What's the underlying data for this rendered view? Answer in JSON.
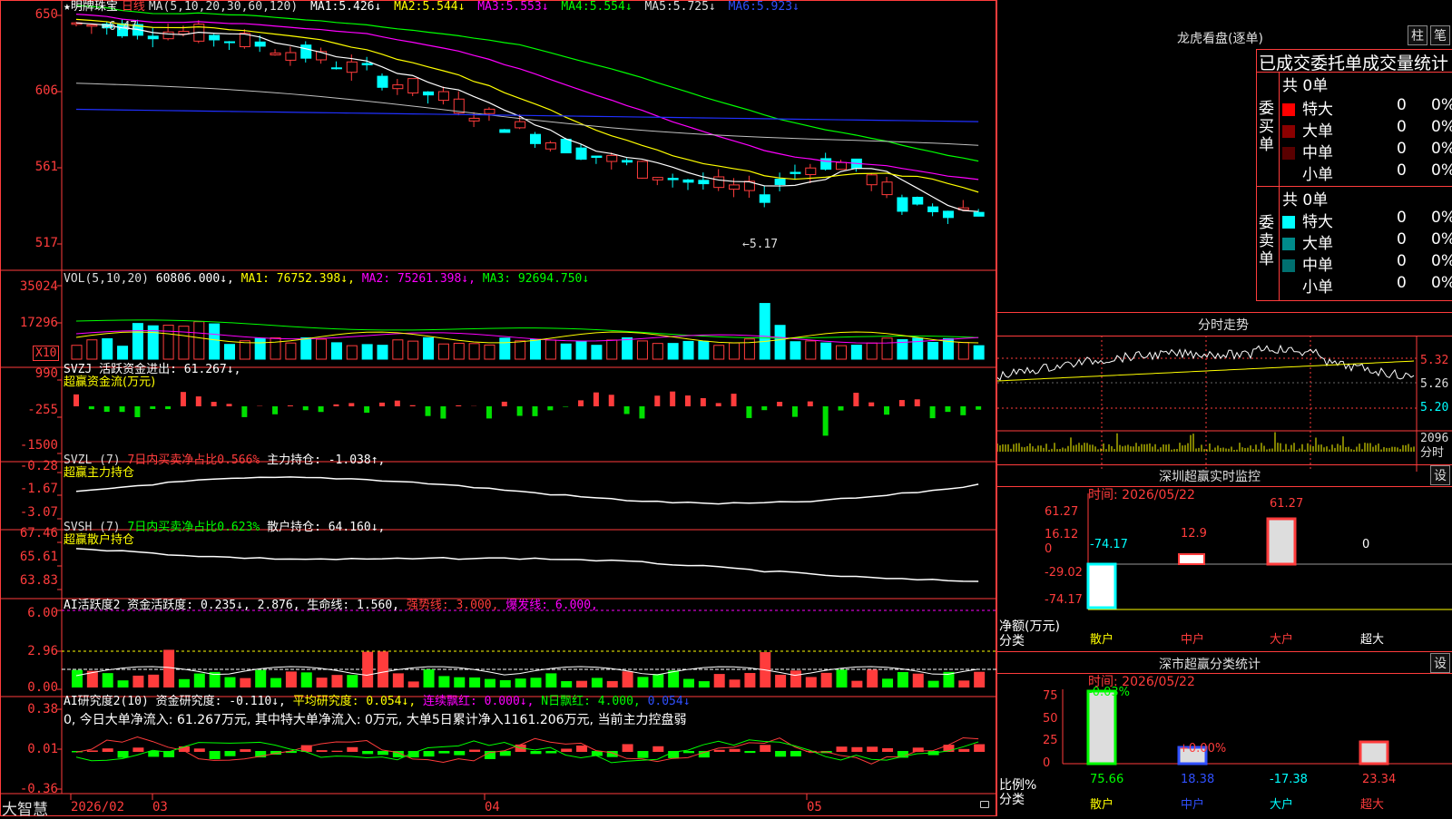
{
  "header": {
    "stock_name": "★明牌珠宝",
    "period": "日线",
    "ma_def": "MA(5,10,20,30,60,120)",
    "ma": [
      {
        "label": "MA1:",
        "value": "5.426↓",
        "color": "#ffffff"
      },
      {
        "label": "MA2:",
        "value": "5.544↓",
        "color": "#ffff00"
      },
      {
        "label": "MA3:",
        "value": "5.553↓",
        "color": "#ff00ff"
      },
      {
        "label": "MA4:",
        "value": "5.554↓",
        "color": "#00ff00"
      },
      {
        "label": "MA5:",
        "value": "5.725↓",
        "color": "#d0d0d0"
      },
      {
        "label": "MA6:",
        "value": "5.923↓",
        "color": "#2020ff"
      }
    ]
  },
  "price_axis": [
    "650",
    "606",
    "561",
    "517"
  ],
  "price_annotations": {
    "high": "←6.47",
    "low": "←5.17"
  },
  "vol": {
    "title": "VOL(5,10,20)",
    "value": "60806.000↓,",
    "ma1": "MA1: 76752.398↓,",
    "ma2": "MA2: 75261.398↓,",
    "ma3": "MA3: 92694.750↓",
    "axis": [
      "35024",
      "17296"
    ],
    "unit": "X10"
  },
  "svzj": {
    "title": "SVZJ  活跃资金进出: 61.267↓,",
    "subtitle": "超赢资金流(万元)",
    "axis": [
      "990",
      "-255",
      "-1500"
    ]
  },
  "svzl": {
    "title": "SVZL (7)",
    "part2": "7日内买卖净占比0.566%",
    "part3": "主力持仓: -1.038↑,",
    "subtitle": "超赢主力持仓",
    "axis": [
      "-0.28",
      "-1.67",
      "-3.07"
    ]
  },
  "svsh": {
    "title": "SVSH (7)",
    "part2": "7日内买卖净占比0.623%",
    "part3": "散户持仓: 64.160↓,",
    "subtitle": "超赢散户持仓",
    "axis": [
      "67.46",
      "65.61",
      "63.83"
    ]
  },
  "ai_active": {
    "title": "AI活跃度2 资金活跃度: 0.235↓, 2.876, 生命线: 1.560,",
    "strong": "强势线: 3.000,",
    "burst": "爆发线: 6.000,",
    "axis": [
      "6.00",
      "2.96",
      "0.00"
    ]
  },
  "ai_research": {
    "title": "AI研究度2(10) 资金研究度: -0.110↓,",
    "avg": "平均研究度: 0.054↓,",
    "red": "连续飘红: 0.000↓,",
    "nred": "N日飘红: 4.000,",
    "last": "0.054↓",
    "desc": "0, 今日大单净流入: 61.267万元, 其中特大单净流入: 0万元, 大单5日累计净入1161.206万元, 当前主力控盘弱",
    "axis": [
      "0.38",
      "0.01",
      "-0.36"
    ]
  },
  "date_axis": {
    "brand": "大智慧",
    "labels": [
      "2026/02",
      "03",
      "04",
      "05"
    ]
  },
  "dragon_tiger": {
    "title": "龙虎看盘(逐单)",
    "btn_bar": "柱",
    "btn_tick": "笔",
    "tabs": "已成交委托单成交量统计",
    "buy_label": "委买单",
    "sell_label": "委卖单",
    "buy_total": "共 0单",
    "sell_total": "共 0单",
    "buy_rows": [
      {
        "name": "特大",
        "count": "0",
        "pct": "0%",
        "color": "#ff0000"
      },
      {
        "name": "大单",
        "count": "0",
        "pct": "0%",
        "color": "#8b0000"
      },
      {
        "name": "中单",
        "count": "0",
        "pct": "0%",
        "color": "#5a0000"
      },
      {
        "name": "小单",
        "count": "0",
        "pct": "0%",
        "color": "#000000"
      }
    ],
    "sell_rows": [
      {
        "name": "特大",
        "count": "0",
        "pct": "0%",
        "color": "#00ffff"
      },
      {
        "name": "大单",
        "count": "0",
        "pct": "0%",
        "color": "#008b8b"
      },
      {
        "name": "中单",
        "count": "0",
        "pct": "0%",
        "color": "#007070"
      },
      {
        "name": "小单",
        "count": "0",
        "pct": "0%",
        "color": "#000000"
      }
    ]
  },
  "intraday": {
    "title": "分时走势",
    "axis": [
      "5.32",
      "5.26",
      "5.20"
    ],
    "vol_top": "2096",
    "vol_unit": "分时"
  },
  "realtime": {
    "title": "深圳超赢实时监控",
    "set": "设",
    "time": "时间: 2026/05/22",
    "axis": [
      "61.27",
      "16.12",
      "0",
      "-29.02",
      "-74.17"
    ],
    "ylabel": "净额(万元)",
    "xlabel": "分类",
    "categories": [
      "散户",
      "中户",
      "大户",
      "超大"
    ],
    "values": [
      "-74.17",
      "12.9",
      "61.27",
      "0"
    ]
  },
  "classify": {
    "title": "深市超赢分类统计",
    "set": "设",
    "time": "时间: 2026/05/22",
    "axis": [
      "75",
      "50",
      "25",
      "0"
    ],
    "ylabel": "比例%",
    "xlabel": "分类",
    "categories": [
      "散户",
      "中户",
      "大户",
      "超大"
    ],
    "top_labels": [
      "-0.03%",
      "+0.00%"
    ],
    "values": [
      "75.66",
      "18.38",
      "-17.38",
      "23.34"
    ]
  },
  "chart_data": {
    "type": "candlestick",
    "title": "明牌珠宝 日线",
    "ylim": [
      5.1,
      6.55
    ],
    "ma_values": {
      "MA1": 5.426,
      "MA2": 5.544,
      "MA3": 5.553,
      "MA4": 5.554,
      "MA5": 5.725,
      "MA6": 5.923
    },
    "high": 6.47,
    "low": 5.17,
    "x_labels": [
      "2026/02",
      "03",
      "04",
      "05"
    ]
  }
}
